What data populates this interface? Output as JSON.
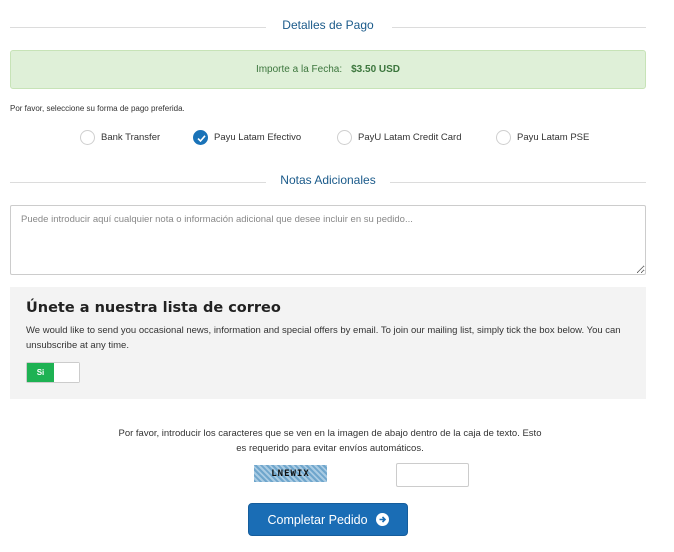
{
  "payment": {
    "title": "Detalles de Pago",
    "amount_label": "Importe a la Fecha:",
    "amount_value": "$3.50 USD",
    "prompt": "Por favor, seleccione su forma de pago preferida.",
    "methods": [
      {
        "label": "Bank Transfer",
        "selected": false
      },
      {
        "label": "Payu Latam Efectivo",
        "selected": true
      },
      {
        "label": "PayU Latam Credit Card",
        "selected": false
      },
      {
        "label": "Payu Latam PSE",
        "selected": false
      }
    ]
  },
  "notes": {
    "title": "Notas Adicionales",
    "placeholder": "Puede introducir aquí cualquier nota o información adicional que desee incluir en su pedido..."
  },
  "mailing": {
    "heading": "Únete a nuestra lista de correo",
    "text": "We would like to send you occasional news, information and special offers by email. To join our mailing list, simply tick the box below. You can unsubscribe at any time.",
    "toggle_label": "Si"
  },
  "captcha": {
    "instructions": "Por favor, introducir los caracteres que se ven en la imagen de abajo dentro de la caja de texto. Esto es requerido para evitar envíos automáticos.",
    "image_text": "LNEWIX",
    "value": ""
  },
  "submit_label": "Completar Pedido",
  "colors": {
    "accent": "#1a6db5",
    "success_bg": "#dff0d8",
    "success_text": "#3c763d",
    "toggle_on": "#1eb253"
  }
}
